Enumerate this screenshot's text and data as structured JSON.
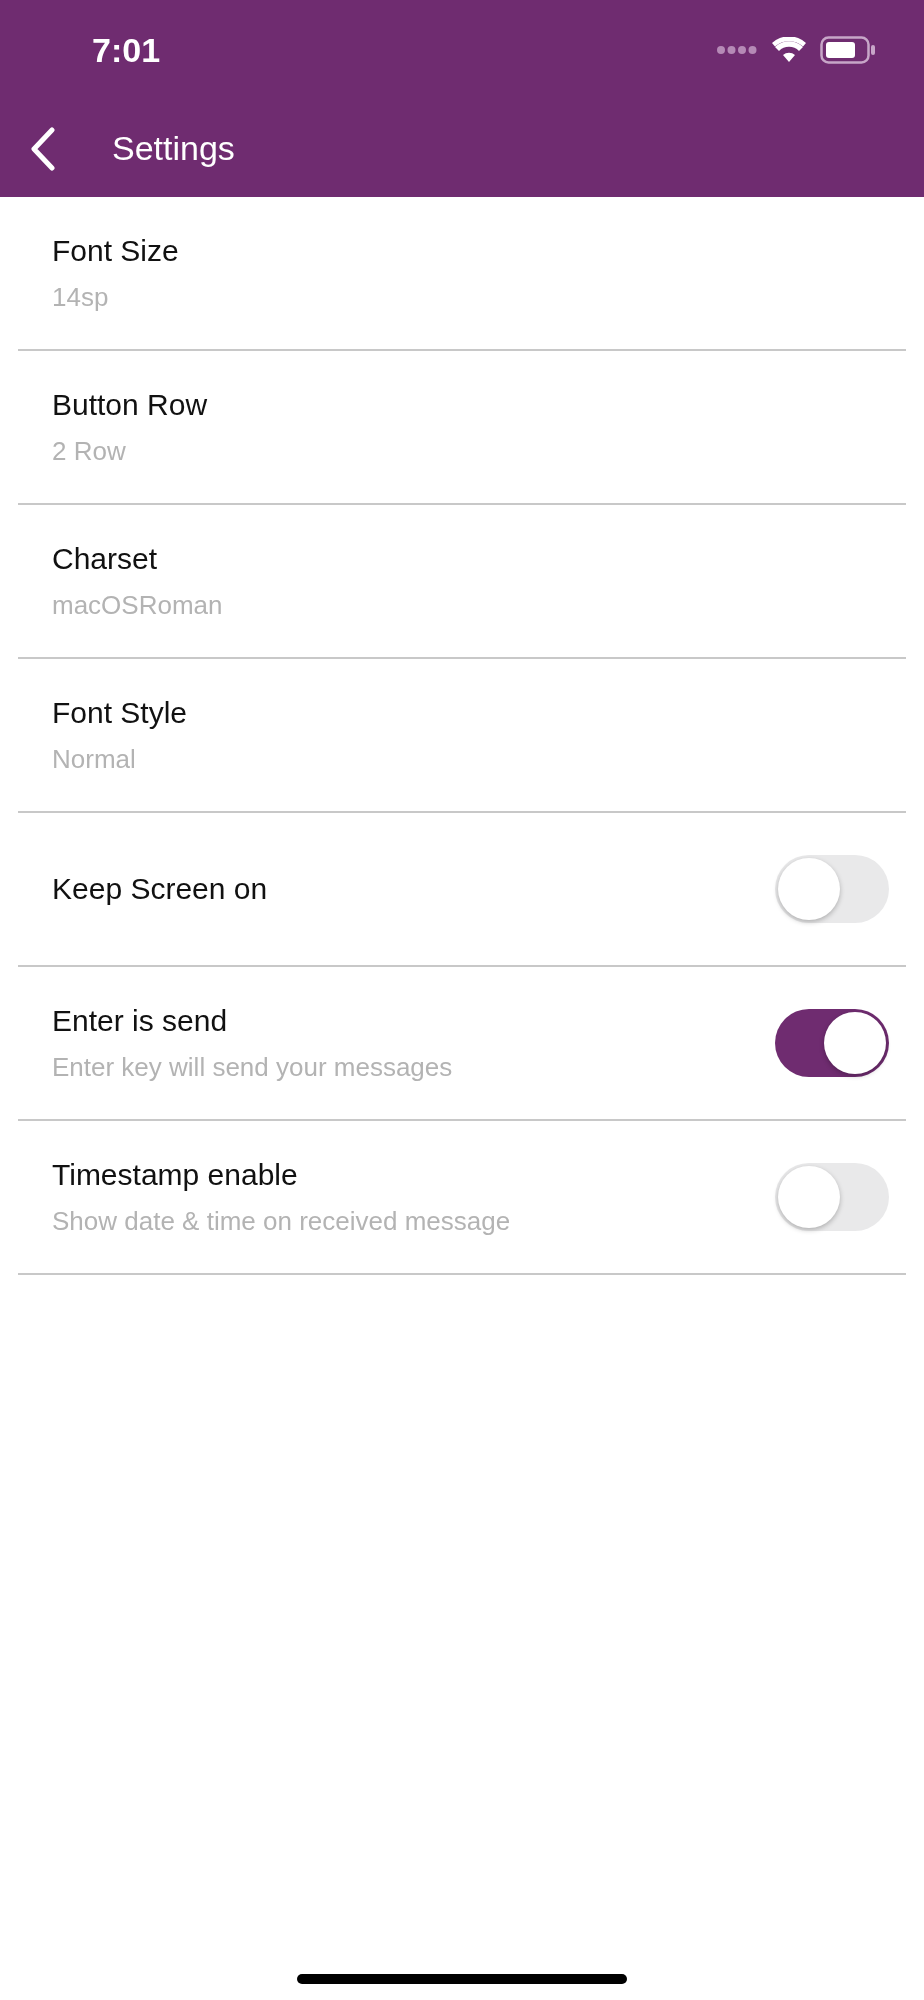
{
  "status_bar": {
    "time": "7:01"
  },
  "nav": {
    "title": "Settings"
  },
  "settings": [
    {
      "kind": "value",
      "title": "Font Size",
      "subtitle": "14sp"
    },
    {
      "kind": "value",
      "title": "Button Row",
      "subtitle": "2 Row"
    },
    {
      "kind": "value",
      "title": "Charset",
      "subtitle": "macOSRoman"
    },
    {
      "kind": "value",
      "title": "Font Style",
      "subtitle": "Normal"
    },
    {
      "kind": "toggle",
      "title": "Keep Screen on",
      "on": false
    },
    {
      "kind": "toggle",
      "title": "Enter is send",
      "subtitle": "Enter key will send your messages",
      "on": true
    },
    {
      "kind": "toggle",
      "title": "Timestamp enable",
      "subtitle": "Show date & time on received message",
      "on": false
    }
  ]
}
